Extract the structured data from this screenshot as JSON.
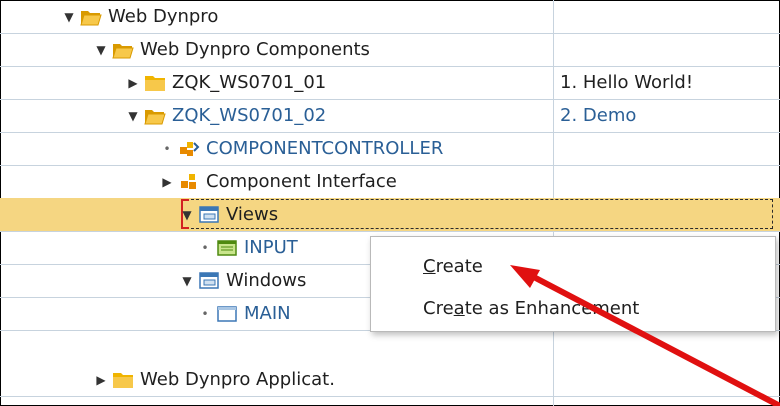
{
  "tree": {
    "rows": [
      {
        "label": "Web Dynpro",
        "desc": ""
      },
      {
        "label": "Web Dynpro Components",
        "desc": ""
      },
      {
        "label": "ZQK_WS0701_01",
        "desc": "1. Hello World!"
      },
      {
        "label": "ZQK_WS0701_02",
        "desc": "2. Demo"
      },
      {
        "label": "COMPONENTCONTROLLER",
        "desc": ""
      },
      {
        "label": "Component Interface",
        "desc": ""
      },
      {
        "label": "Views",
        "desc": ""
      },
      {
        "label": "INPUT",
        "desc": ""
      },
      {
        "label": "Windows",
        "desc": ""
      },
      {
        "label": "MAIN",
        "desc": ""
      },
      {
        "label": "Web Dynpro Applicat.",
        "desc": ""
      }
    ]
  },
  "context_menu": {
    "create": {
      "pre": "",
      "mnemonic": "C",
      "post": "reate"
    },
    "create_enh": {
      "pre": "Cre",
      "mnemonic": "a",
      "post": "te as Enhancement"
    }
  },
  "colors": {
    "selected_row": "#f5d682",
    "folder": "#f0b400",
    "link_blue": "#2a5f96",
    "annotation_arrow": "#e01010"
  }
}
